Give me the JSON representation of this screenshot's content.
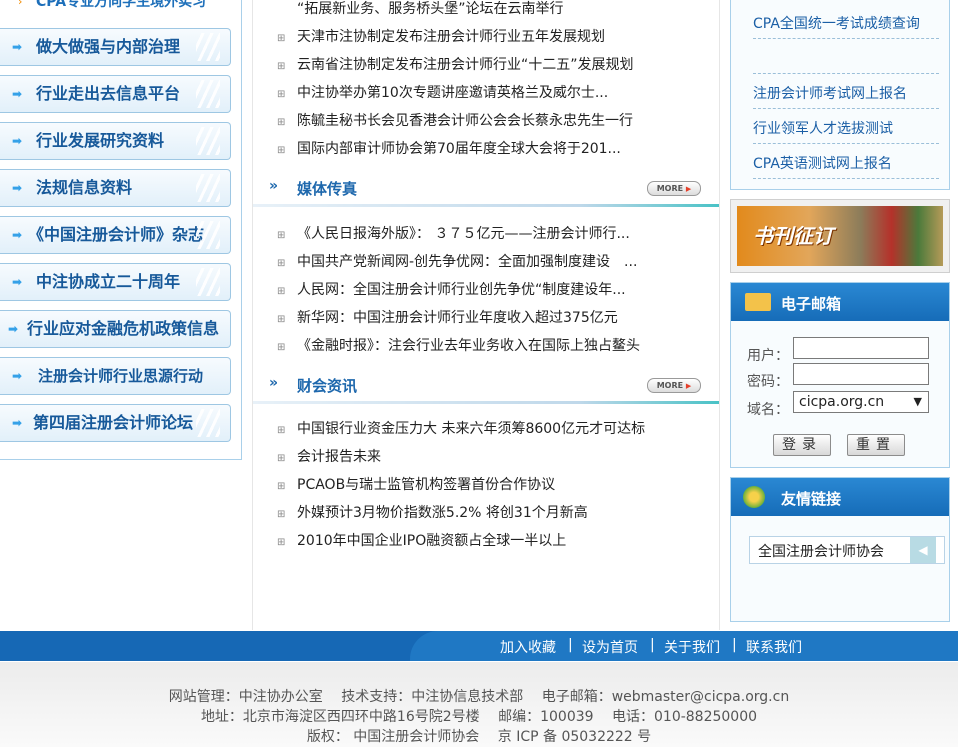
{
  "left_nav": {
    "top_item": "CPA专业方向学生境外实习",
    "items": [
      "做大做强与内部治理",
      "行业走出去信息平台",
      "行业发展研究资料",
      "法规信息资料",
      "《中国注册会计师》杂志",
      "中注协成立二十周年",
      "行业应对金融危机政策信息",
      "注册会计师行业思源行动",
      "第四届注册会计师论坛"
    ]
  },
  "news_top": [
    "“拓展新业务、服务桥头堡”论坛在云南举行",
    "天津市注协制定发布注册会计师行业五年发展规划",
    "云南省注协制定发布注册会计师行业“十二五”发展规划",
    "中注协举办第10次专题讲座邀请英格兰及威尔士...",
    "陈毓圭秘书长会见香港会计师公会会长蔡永忠先生一行",
    "国际内部审计师协会第70届年度全球大会将于201..."
  ],
  "media": {
    "title": "媒体传真",
    "more": "MORE",
    "items": [
      "《人民日报海外版》： ３７５亿元——注册会计师行...",
      "中国共产党新闻网-创先争优网：全面加强制度建设　...",
      "人民网：全国注册会计师行业创先争优“制度建设年...",
      "新华网：中国注册会计师行业年度收入超过375亿元",
      "《金融时报》：注会行业去年业务收入在国际上独占鳌头"
    ]
  },
  "finance": {
    "title": "财会资讯",
    "more": "MORE",
    "items": [
      "中国银行业资金压力大 未来六年须筹8600亿元才可达标",
      "会计报告未来",
      "PCAOB与瑞士监管机构签署首份合作协议",
      "外媒预计3月物价指数涨5.2% 将创31个月新高",
      "2010年中国企业IPO融资额占全球一半以上"
    ]
  },
  "right": {
    "links": [
      "CPA全国统一考试成绩查询",
      "",
      "注册会计师考试网上报名",
      "行业领军人才选拔测试",
      "CPA英语测试网上报名"
    ],
    "banner_text": "书刊征订",
    "email": {
      "title": "电子邮箱",
      "user_label": "用户：",
      "password_label": "密码：",
      "domain_label": "域名：",
      "domain_value": "cicpa.org.cn",
      "login": "登录",
      "reset": "重置"
    },
    "friends": {
      "title": "友情链接",
      "selected": "全国注册会计师协会"
    }
  },
  "footer": {
    "links": [
      "加入收藏",
      "设为首页",
      "关于我们",
      "联系我们"
    ],
    "separator": "|",
    "line1": "网站管理：中注协办公室　 技术支持：中注协信息技术部　 电子邮箱：webmaster@cicpa.org.cn",
    "line2": "地址：北京市海淀区西四环中路16号院2号楼　 邮编：100039　 电话：010-88250000",
    "line3": "版权：  中国注册会计师协会　 京 ICP 备 05032222 号"
  },
  "colors": {
    "brand_blue": "#1668b5",
    "nav_text": "#17599a",
    "link_blue": "#1b5fa6"
  }
}
